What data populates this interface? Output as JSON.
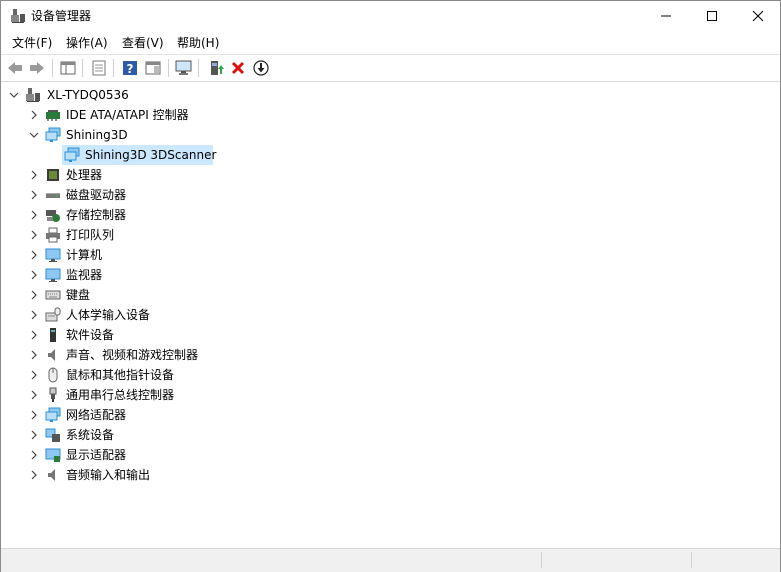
{
  "window": {
    "title": "设备管理器"
  },
  "menu": [
    {
      "label": "文件(F)"
    },
    {
      "label": "操作(A)"
    },
    {
      "label": "查看(V)"
    },
    {
      "label": "帮助(H)"
    }
  ],
  "toolbar": [
    "back-icon",
    "forward-icon",
    "show-hide-console-tree-icon",
    "properties-icon",
    "help-icon",
    "action-pane-icon",
    "scan-hardware-icon",
    "update-driver-icon",
    "uninstall-device-icon",
    "disable-device-icon"
  ],
  "tree": {
    "root": "XL-TYDQ0536",
    "items": [
      {
        "label": "IDE ATA/ATAPI 控制器"
      },
      {
        "label": "Shining3D"
      },
      {
        "label": "Shining3D 3DScanner"
      },
      {
        "label": "处理器"
      },
      {
        "label": "磁盘驱动器"
      },
      {
        "label": "存储控制器"
      },
      {
        "label": "打印队列"
      },
      {
        "label": "计算机"
      },
      {
        "label": "监视器"
      },
      {
        "label": "键盘"
      },
      {
        "label": "人体学输入设备"
      },
      {
        "label": "软件设备"
      },
      {
        "label": "声音、视频和游戏控制器"
      },
      {
        "label": "鼠标和其他指针设备"
      },
      {
        "label": "通用串行总线控制器"
      },
      {
        "label": "网络适配器"
      },
      {
        "label": "系统设备"
      },
      {
        "label": "显示适配器"
      },
      {
        "label": "音频输入和输出"
      }
    ]
  },
  "colors": {
    "selection": "#cce8ff",
    "network_icon": "#2e8fd6",
    "uninstall_red": "#e01010",
    "update_green": "#2aa84a"
  }
}
